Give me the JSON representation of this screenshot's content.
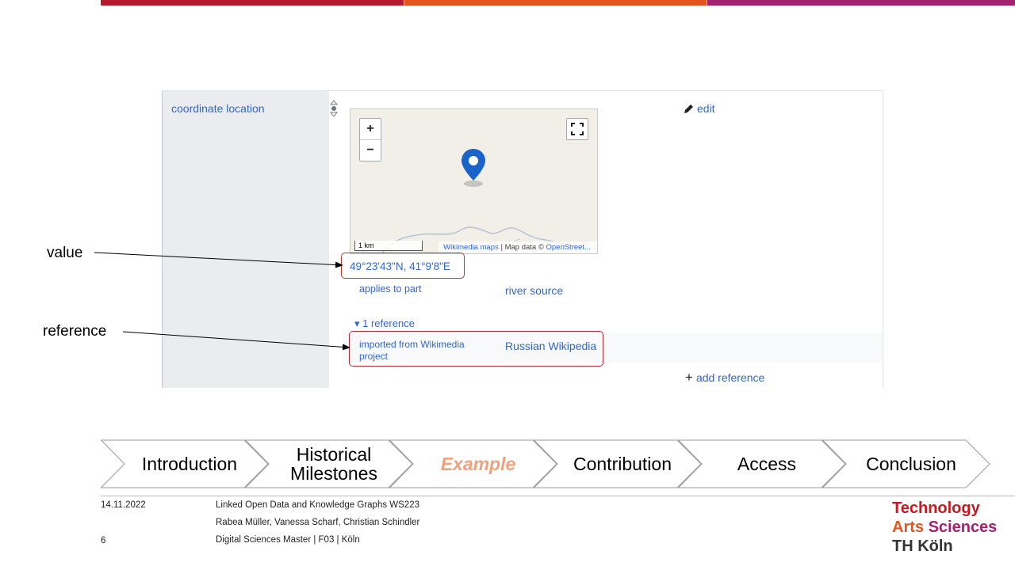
{
  "wikidata": {
    "property_label": "coordinate location",
    "edit_label": "edit",
    "coordinate_value": "49°23'43\"N, 41°9'8\"E",
    "map": {
      "zoom_in": "+",
      "zoom_out": "−",
      "scale": "1 km",
      "attribution_link": "Wikimedia maps",
      "attribution_text": " | Map data © ",
      "attribution_osm": "OpenStreet..."
    },
    "qualifier_property": "applies to part",
    "qualifier_value": "river source",
    "references_toggle": "▾ 1 reference",
    "reference_property": "imported from Wikimedia project",
    "reference_value": "Russian Wikipedia",
    "add_reference": "add reference"
  },
  "callouts": {
    "value": "value",
    "reference": "reference"
  },
  "nav": {
    "items": [
      {
        "label": "Introduction",
        "active": false
      },
      {
        "label": "Historical Milestones",
        "active": false
      },
      {
        "label": "Example",
        "active": true
      },
      {
        "label": "Contribution",
        "active": false
      },
      {
        "label": "Access",
        "active": false
      },
      {
        "label": "Conclusion",
        "active": false
      }
    ]
  },
  "footer": {
    "date": "14.11.2022",
    "course": "Linked Open Data and Knowledge Graphs WS223",
    "authors": "Rabea Müller, Vanessa Scharf, Christian Schindler",
    "page_number": "6",
    "program": "Digital Sciences Master | F03 | Köln"
  },
  "logo": {
    "line1": "Technology",
    "line2a": "Arts",
    "line2b": "Sciences",
    "line3": "TH Köln"
  },
  "colors": {
    "bar_red": "#b5192d",
    "bar_orange": "#e2541c",
    "bar_purple": "#a3216f",
    "link_blue": "#3366cc",
    "highlight_red": "#b22a33",
    "active_nav": "#f0a07a"
  }
}
